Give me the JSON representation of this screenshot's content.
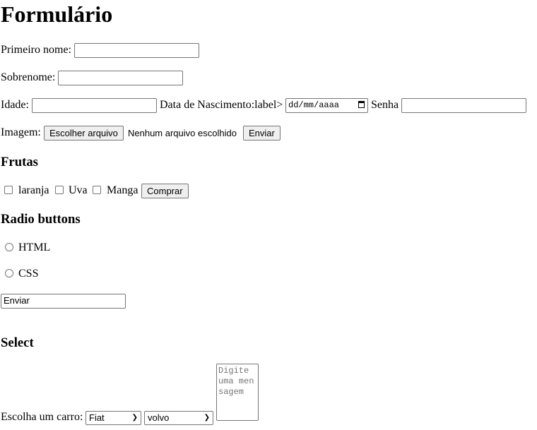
{
  "title": "Formulário",
  "first_name": {
    "label": "Primeiro nome:",
    "value": ""
  },
  "last_name": {
    "label": "Sobrenome:",
    "value": ""
  },
  "age": {
    "label": "Idade:",
    "value": ""
  },
  "birth": {
    "label": "Data de Nascimento:label>",
    "placeholder": "dd/mm/aaaa"
  },
  "password": {
    "label": "Senha",
    "value": ""
  },
  "image": {
    "label": "Imagem:",
    "button": "Escolher arquivo",
    "status": "Nenhum arquivo escolhido",
    "submit": "Enviar"
  },
  "fruits": {
    "heading": "Frutas",
    "options": [
      "laranja",
      "Uva",
      "Manga"
    ],
    "button": "Comprar"
  },
  "radios": {
    "heading": "Radio buttons",
    "options": [
      "HTML",
      "CSS"
    ]
  },
  "text_submit": {
    "value": "Enviar"
  },
  "select": {
    "heading": "Select",
    "label": "Escolha um carro:",
    "car1": "Fiat",
    "car2": "volvo",
    "textarea_placeholder": "Digite uma mensagem"
  }
}
